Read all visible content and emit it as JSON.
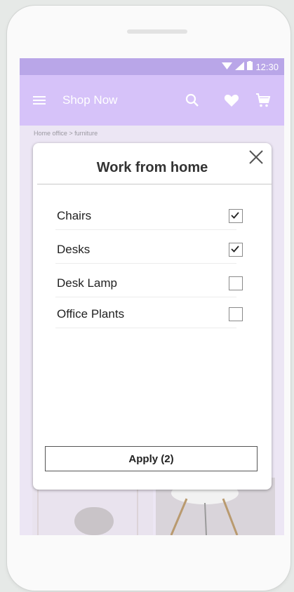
{
  "status_bar": {
    "time": "12:30"
  },
  "app_bar": {
    "title": "Shop Now",
    "icons": [
      "menu-icon",
      "search-icon",
      "heart-icon",
      "cart-icon"
    ]
  },
  "breadcrumb": "Home office > furniture",
  "modal": {
    "title": "Work from home",
    "options": [
      {
        "label": "Chairs",
        "checked": true
      },
      {
        "label": "Desks",
        "checked": true
      },
      {
        "label": "Desk Lamp",
        "checked": false
      },
      {
        "label": "Office Plants",
        "checked": false
      }
    ],
    "apply_label": "Apply (2)"
  },
  "colors": {
    "status_bar": "#b9a6e8",
    "app_bar": "#d6c2f9",
    "background": "#ece6f4"
  }
}
